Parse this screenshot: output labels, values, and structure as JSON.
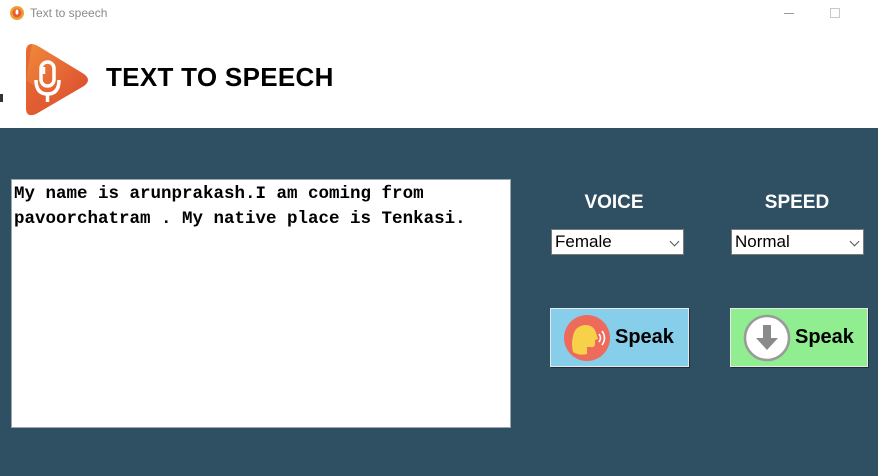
{
  "window": {
    "title": "Text to speech"
  },
  "header": {
    "title": "TEXT TO SPEECH"
  },
  "textbox": {
    "value": "My name is arunprakash.I am coming from pavoorchatram . My native place is Tenkasi."
  },
  "voice": {
    "label": "VOICE",
    "selected": "Female"
  },
  "speed": {
    "label": "SPEED",
    "selected": "Normal"
  },
  "buttons": {
    "speak_label": "Speak",
    "download_label": "Speak"
  },
  "colors": {
    "panel": "#2f4f62",
    "speak_button": "#87ceeb",
    "download_button": "#90ee90",
    "logo": "#e8683a"
  }
}
